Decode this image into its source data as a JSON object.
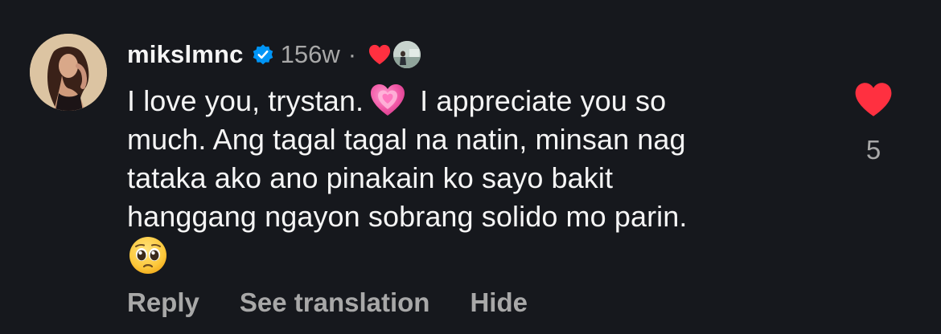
{
  "comment": {
    "username": "mikslmnc",
    "time": "156w",
    "separator": "·",
    "text_line1_a": "I love you, trystan.",
    "text_line1_b": "I appreciate you so",
    "text_line2": "much. Ang tagal tagal na natin, minsan nag",
    "text_line3": "tataka ako ano pinakain ko sayo bakit",
    "text_line4": "hanggang ngayon sobrang solido mo parin.",
    "like_count": "5"
  },
  "actions": {
    "reply": "Reply",
    "see_translation": "See translation",
    "hide": "Hide"
  },
  "icons": {
    "verified": "verified-badge-icon",
    "creator_like": "red-heart-icon",
    "pink_heart_emoji": "growing-heart-emoji",
    "pleading_emoji": "pleading-face-emoji",
    "like": "like-heart-icon"
  },
  "colors": {
    "background": "#16181d",
    "text": "#f5f5f5",
    "secondary_text": "#a8a8a8",
    "like_red": "#ff3040",
    "verified_blue": "#0095f6"
  }
}
